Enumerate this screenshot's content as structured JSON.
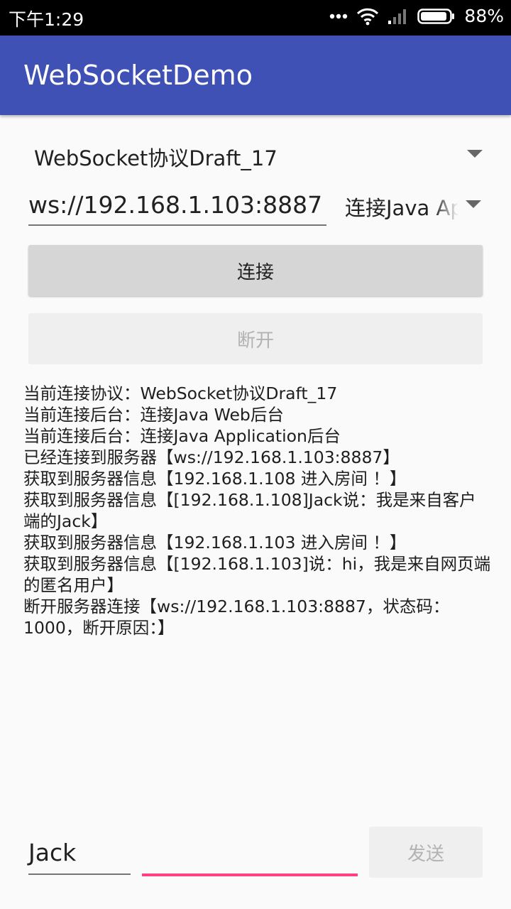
{
  "status_bar": {
    "time": "下午1:29",
    "battery": "88%",
    "icons": [
      "more-dots-icon",
      "wifi-icon",
      "signal-icon",
      "battery-icon"
    ]
  },
  "app_bar": {
    "title": "WebSocketDemo"
  },
  "protocol_spinner": {
    "selected": "WebSocket协议Draft_17"
  },
  "url_input": {
    "value": "ws://192.168.1.103:8887"
  },
  "backend_spinner": {
    "selected": "连接Java Application后台"
  },
  "buttons": {
    "connect": "连接",
    "disconnect": "断开",
    "send": "发送"
  },
  "log_lines": [
    "当前连接协议：WebSocket协议Draft_17",
    "当前连接后台：连接Java Web后台",
    "当前连接后台：连接Java Application后台",
    "已经连接到服务器【ws://192.168.1.103:8887】",
    "获取到服务器信息【192.168.1.108 进入房间 ！】",
    "获取到服务器信息【[192.168.1.108]Jack说：我是来自客户端的Jack】",
    "获取到服务器信息【192.168.1.103 进入房间 ！】",
    "获取到服务器信息【[192.168.1.103]说：hi，我是来自网页端的匿名用户】",
    "断开服务器连接【ws://192.168.1.103:8887，状态码：1000，断开原因：】"
  ],
  "name_input": {
    "value": "Jack"
  },
  "message_input": {
    "value": ""
  },
  "colors": {
    "primary": "#3f51b5",
    "accent": "#ff4081",
    "status_bar": "#000000"
  }
}
